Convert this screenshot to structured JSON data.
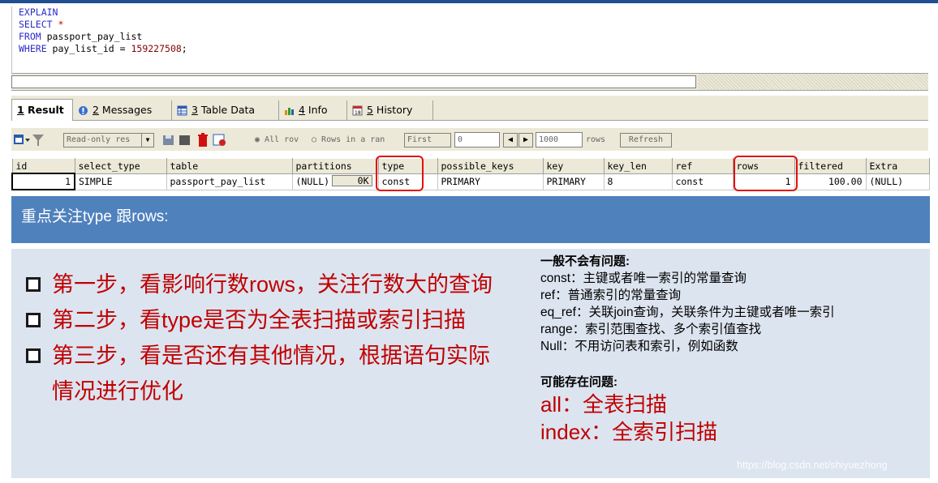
{
  "sql": {
    "line1_kw": "EXPLAIN",
    "line2_kw": "SELECT",
    "line2_star": "*",
    "line3_kw": "FROM",
    "line3_rest": " passport_pay_list",
    "line4_kw": "WHERE",
    "line4_rest": " pay_list_id = ",
    "line4_num": "159227508",
    "line4_end": ";"
  },
  "tabs": [
    {
      "num": "1",
      "label": " Result",
      "icon": "result-icon"
    },
    {
      "num": "2",
      "label": " Messages",
      "icon": "messages-icon"
    },
    {
      "num": "3",
      "label": " Table Data",
      "icon": "table-data-icon"
    },
    {
      "num": "4",
      "label": " Info",
      "icon": "info-icon"
    },
    {
      "num": "5",
      "label": " History",
      "icon": "history-icon"
    }
  ],
  "toolbar": {
    "mode_select": "Read-only res",
    "radio_all": "All rov",
    "radio_range": "Rows in a ran",
    "first_label": "First",
    "first_value": "0",
    "count_value": "1000",
    "rows_label": "rows",
    "refresh_label": "Refresh"
  },
  "grid": {
    "columns": [
      "id",
      "select_type",
      "table",
      "partitions",
      "type",
      "possible_keys",
      "key",
      "key_len",
      "ref",
      "rows",
      "filtered",
      "Extra"
    ],
    "row": {
      "id": "1",
      "select_type": "SIMPLE",
      "table": "passport_pay_list",
      "partitions": "(NULL)",
      "partitions_size": "0K",
      "type": "const",
      "possible_keys": "PRIMARY",
      "key": "PRIMARY",
      "key_len": "8",
      "ref": "const",
      "rows": "1",
      "filtered": "100.00",
      "extra": "(NULL)"
    }
  },
  "banner": {
    "text": "重点关注type 跟rows:"
  },
  "steps": {
    "step1": "第一步，看影响行数rows，关注行数大的查询",
    "step2": "第二步，看type是否为全表扫描或索引扫描",
    "step3": "第三步，看是否还有其他情况，根据语句实际",
    "step3_cont": "情况进行优化"
  },
  "notes": {
    "ok_heading": "一般不会有问题:",
    "ok_items": [
      "const：主键或者唯一索引的常量查询",
      "ref：普通索引的常量查询",
      "eq_ref：关联join查询，关联条件为主键或者唯一索引",
      "range：索引范围查找、多个索引值查找",
      "Null：不用访问表和索引，例如函数"
    ],
    "bad_heading": "可能存在问题:",
    "bad_items": [
      "all：全表扫描",
      "index：全索引扫描"
    ]
  },
  "watermark": "https://blog.csdn.net/shiyuezhong",
  "colors": {
    "banner": "#4f81bd",
    "panel": "#dce4ef",
    "accent_red": "#c00000",
    "highlight_red": "#e01010",
    "sql_keyword": "#2b2bc8"
  }
}
